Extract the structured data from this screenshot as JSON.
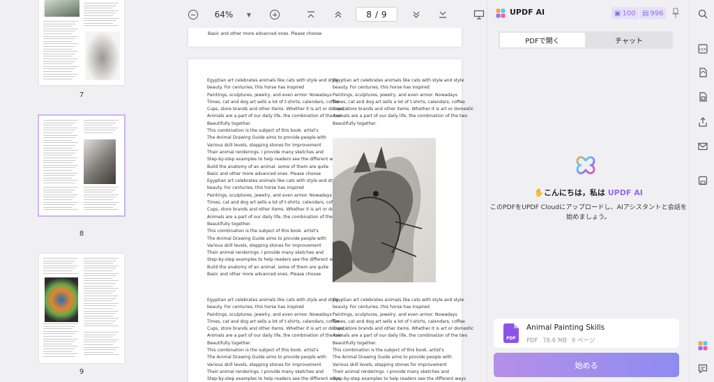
{
  "thumbnails": [
    {
      "page_label": "7",
      "selected": false
    },
    {
      "page_label": "8",
      "selected": true
    },
    {
      "page_label": "9",
      "selected": false
    }
  ],
  "toolbar": {
    "zoom_out_icon": "zoom-out-icon",
    "zoom_level": "64%",
    "zoom_dropdown_icon": "caret-down-icon",
    "zoom_in_icon": "zoom-in-icon",
    "first_page_icon": "first-page-icon",
    "prev_page_icon": "prev-page-icon",
    "page_current": "8",
    "page_separator": "/",
    "page_total": "9",
    "next_page_icon": "next-page-icon",
    "last_page_icon": "last-page-icon",
    "present_icon": "presentation-icon"
  },
  "document": {
    "top_fragment": "Basic and other more advanced ones. Please choose",
    "text_block": [
      "Egyptian art celebrates animals like cats with style and style",
      "beauty. For centuries, this horse has inspired",
      "Paintings, sculptures, jewelry, and even armor. Nowadays",
      "Times, cat and dog art sells a lot of t-shirts, calendars, coffee",
      "Cups, store brands and other items. Whether it is art or domestic",
      "Animals are a part of our daily life, the combination of the two",
      "Beautifully together.",
      "This combination is the subject of this book. artist's",
      "The Animal Drawing Guide aims to provide people with",
      "Various skill levels, stepping stones for improvement",
      "Their animal renderings. I provide many sketches and",
      "Step-by-step examples to help readers see the different ways",
      "Build the anatomy of an animal. some of them are quite",
      "Basic and other more advanced ones. Please choose"
    ]
  },
  "ai": {
    "logo_icon": "updf-ai-logo-icon",
    "title": "UPDF AI",
    "credits_icon": "document-credit-icon",
    "credits_value": "100",
    "chat_credits_icon": "chat-credit-icon",
    "chat_credits_value": "996",
    "pin_icon": "pin-icon",
    "tab_open_pdf": "PDFで開く",
    "tab_chat": "チャット",
    "greeting_prefix": "こんにちは，私は",
    "greeting_name": "UPDF AI",
    "wave_icon": "waving-hand-icon",
    "description_line1": "このPDFをUPDF Cloudにアップロードし、AIアシスタントと会話を",
    "description_line2": "始めましょう。",
    "file_icon": "pdf-file-icon",
    "file_icon_label": "PDF",
    "file_name": "Animal Painting Skills",
    "file_type": "PDF",
    "file_size": "78.6 MB",
    "file_pages": "9 ページ",
    "start_button": "始める"
  },
  "right_sidebar": [
    "search-icon",
    "ocr-icon",
    "convert-icon",
    "protect-icon",
    "share-icon",
    "email-icon",
    "save-icon",
    "updf-ai-icon",
    "comment-icon"
  ],
  "right_sidebar_ocr_label": "OCR",
  "colors": {
    "accent": "#8e6cf2",
    "ai_gradient_start": "#b68fe8",
    "ai_gradient_end": "#8e8cf1",
    "pdf_icon": "#8a55e6"
  }
}
